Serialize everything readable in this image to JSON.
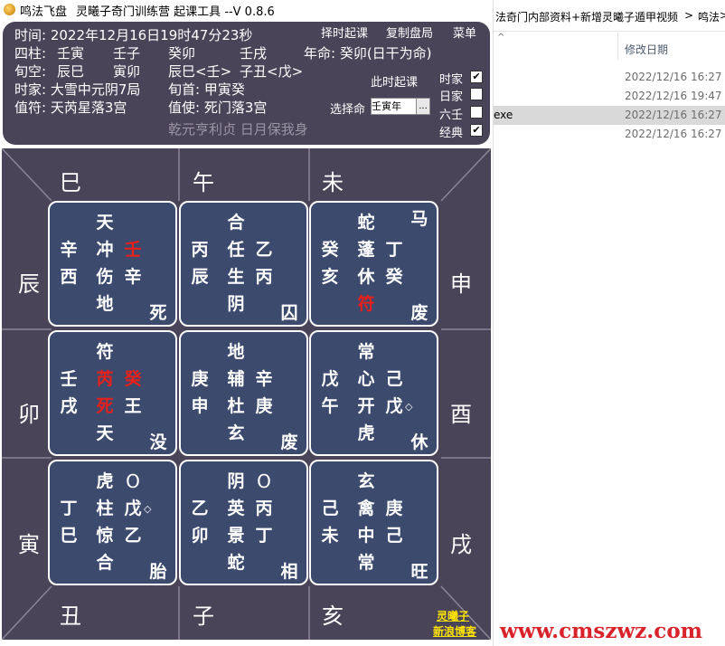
{
  "window": {
    "app_name": "鸣法飞盘",
    "title": "灵曦子奇门训练营 起课工具 --V 0.8.6"
  },
  "header": {
    "time": "时间: 2022年12月16日19时47分23秒",
    "pillars": [
      "四柱:",
      "壬寅",
      "壬子",
      "癸卯",
      "壬戌"
    ],
    "life": "年命: 癸卯(日干为命)",
    "kong": [
      "旬空:",
      "辰巳",
      "寅卯",
      "辰巳<壬>",
      "子丑<戊>"
    ],
    "shijia": "时家: 大雪中元阴7局",
    "xunshou": "旬首: 甲寅癸",
    "zhifu": "值符: 天芮星落3宫",
    "zhishi": "值使: 死门落3宫",
    "slogan": "乾元亨利贞 日月保我身",
    "buttons": {
      "zeshi": "择时起课",
      "copy": "复制盘局",
      "menu": "菜单",
      "now": "此时起课"
    },
    "select_label": "选择命",
    "select_value": "壬寅年",
    "select_btn": "...",
    "options": [
      {
        "label": "时家",
        "checked": "✔"
      },
      {
        "label": "日家",
        "checked": ""
      },
      {
        "label": "六壬",
        "checked": ""
      },
      {
        "label": "经典",
        "checked": "✔"
      }
    ]
  },
  "branches": {
    "top": [
      "巳",
      "午",
      "未"
    ],
    "left": [
      "辰",
      "卯",
      "寅"
    ],
    "right": [
      "申",
      "酉",
      "戌"
    ],
    "bottom": [
      "丑",
      "子",
      "亥"
    ]
  },
  "palaces": [
    {
      "name": "xun",
      "god": "天",
      "star": "冲",
      "door": "伤",
      "deity": "地",
      "h1": "辛",
      "h2": "壬",
      "e1": "西",
      "e2": "辛",
      "corner": "",
      "state": "死"
    },
    {
      "name": "li",
      "god": "合",
      "star": "任",
      "door": "生",
      "deity": "阴",
      "h1": "丙",
      "h2": "乙",
      "e1": "辰",
      "e2": "丙",
      "corner": "",
      "state": "囚"
    },
    {
      "name": "kun",
      "god": "蛇",
      "star": "蓬",
      "door": "休",
      "deity": "符",
      "h1": "癸",
      "h2": "丁",
      "e1": "亥",
      "e2": "癸",
      "corner": "马",
      "state": "废"
    },
    {
      "name": "zhen",
      "god": "符",
      "star": "芮",
      "door": "死",
      "deity": "天",
      "h1": "壬",
      "h2": "癸",
      "e1": "戌",
      "e2": "王",
      "corner": "",
      "state": "没"
    },
    {
      "name": "zhong",
      "god": "地",
      "star": "辅",
      "door": "杜",
      "deity": "玄",
      "h1": "庚",
      "h2": "辛",
      "e1": "申",
      "e2": "庚",
      "corner": "",
      "state": "废"
    },
    {
      "name": "dui",
      "god": "常",
      "star": "心",
      "door": "开",
      "deity": "虎",
      "h1": "戊",
      "h2": "己",
      "e1": "午",
      "e2": "戊",
      "corner": "◇",
      "state": "休"
    },
    {
      "name": "gen",
      "god": "虎",
      "star": "柱",
      "door": "惊",
      "deity": "合",
      "h1": "丁",
      "h2": "戊",
      "e1": "巳",
      "e2": "乙",
      "corner": "◇",
      "mark": "O",
      "state": "胎"
    },
    {
      "name": "kan",
      "god": "阴",
      "star": "英",
      "door": "景",
      "deity": "蛇",
      "h1": "乙",
      "h2": "丙",
      "e1": "卯",
      "e2": "丁",
      "corner": "",
      "mark": "O",
      "state": "相"
    },
    {
      "name": "qian",
      "god": "玄",
      "star": "禽",
      "door": "中",
      "deity": "常",
      "h1": "己",
      "h2": "庚",
      "e1": "未",
      "e2": "己",
      "corner": "",
      "state": "旺"
    }
  ],
  "brand": {
    "line1": "灵曦子",
    "line2": "新浪博客"
  },
  "explorer": {
    "breadcrumb": [
      "法奇门内部资料+新增灵曦子遁甲视频",
      ">",
      "鸣法",
      ">"
    ],
    "column_header": "修改日期",
    "rows": [
      {
        "ext": "",
        "date": "2022/12/16 16:27"
      },
      {
        "ext": "",
        "date": "2022/12/16 19:47"
      },
      {
        "ext": "exe",
        "date": "2022/12/16 16:27"
      },
      {
        "ext": "",
        "date": "2022/12/16 16:27"
      }
    ]
  },
  "watermark": "www.cmszwz.com"
}
